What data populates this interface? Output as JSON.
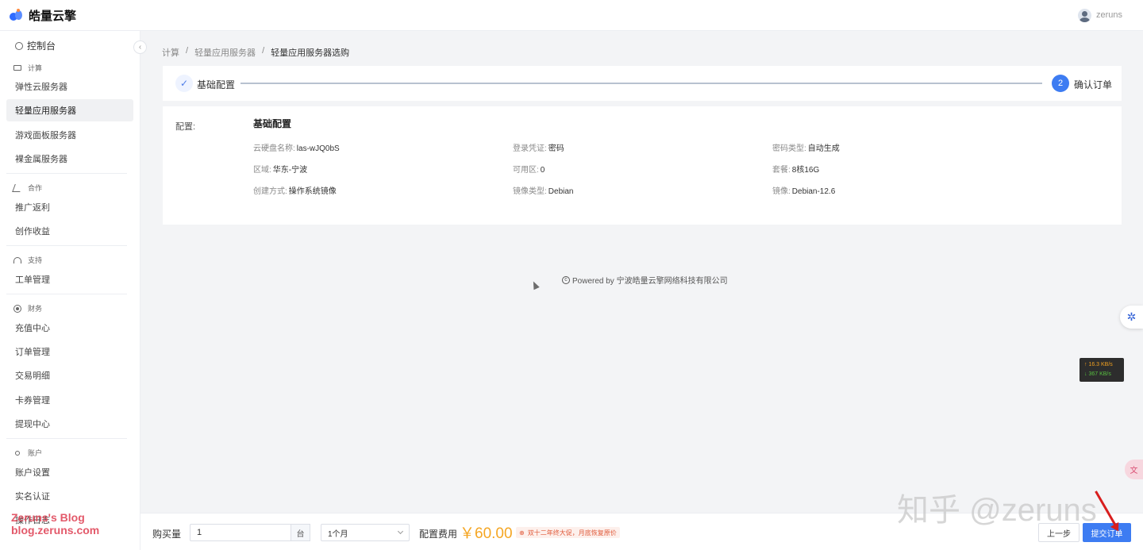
{
  "header": {
    "brand": "皓量云擎",
    "username": "zeruns"
  },
  "sidebar": {
    "dashboard": "控制台",
    "groups": [
      {
        "title": "计算",
        "items": [
          "弹性云服务器",
          "轻量应用服务器",
          "游戏面板服务器",
          "裸金属服务器"
        ]
      },
      {
        "title": "合作",
        "items": [
          "推广返利",
          "创作收益"
        ]
      },
      {
        "title": "支持",
        "items": [
          "工单管理"
        ]
      },
      {
        "title": "财务",
        "items": [
          "充值中心",
          "订单管理",
          "交易明细",
          "卡券管理",
          "提现中心"
        ]
      },
      {
        "title": "账户",
        "items": [
          "账户设置",
          "实名认证",
          "操作日志"
        ]
      }
    ],
    "active_item": "轻量应用服务器"
  },
  "breadcrumb": [
    "计算",
    "轻量应用服务器",
    "轻量应用服务器选购"
  ],
  "steps": {
    "step1": {
      "label": "基础配置",
      "icon": "check-icon"
    },
    "step2": {
      "number": "2",
      "label": "确认订单"
    }
  },
  "config": {
    "label": "配置:",
    "title": "基础配置",
    "fields": [
      {
        "key": "云硬盘名称:",
        "value": "las-wJQ0bS"
      },
      {
        "key": "登录凭证:",
        "value": "密码"
      },
      {
        "key": "密码类型:",
        "value": "自动生成"
      },
      {
        "key": "区域:",
        "value": "华东-宁波"
      },
      {
        "key": "可用区:",
        "value": "0"
      },
      {
        "key": "套餐:",
        "value": "8核16G"
      },
      {
        "key": "创建方式:",
        "value": "操作系统镜像"
      },
      {
        "key": "镜像类型:",
        "value": "Debian"
      },
      {
        "key": "镜像:",
        "value": "Debian-12.6"
      }
    ]
  },
  "footer": {
    "powered": "Powered by 宁波皓量云擎网络科技有限公司"
  },
  "netspeed": {
    "up": "↑ 16.3 KB/s",
    "down": "↓ 367 KB/s"
  },
  "bottom": {
    "qty_label": "购买量",
    "qty_value": "1",
    "qty_unit": "台",
    "period": "1个月",
    "fee_label": "配置费用",
    "fee_value": "￥60.00",
    "promo": "双十二年终大促，月底恢复原价",
    "prev_label": "上一步",
    "submit_label": "提交订单"
  },
  "watermarks": {
    "blog_line1": "Zeruns's Blog",
    "blog_line2": "blog.zeruns.com",
    "zhihu": "知乎 @zeruns"
  },
  "colors": {
    "primary": "#3d7cf2",
    "price": "#f5a623",
    "promo": "#e05a3a"
  }
}
